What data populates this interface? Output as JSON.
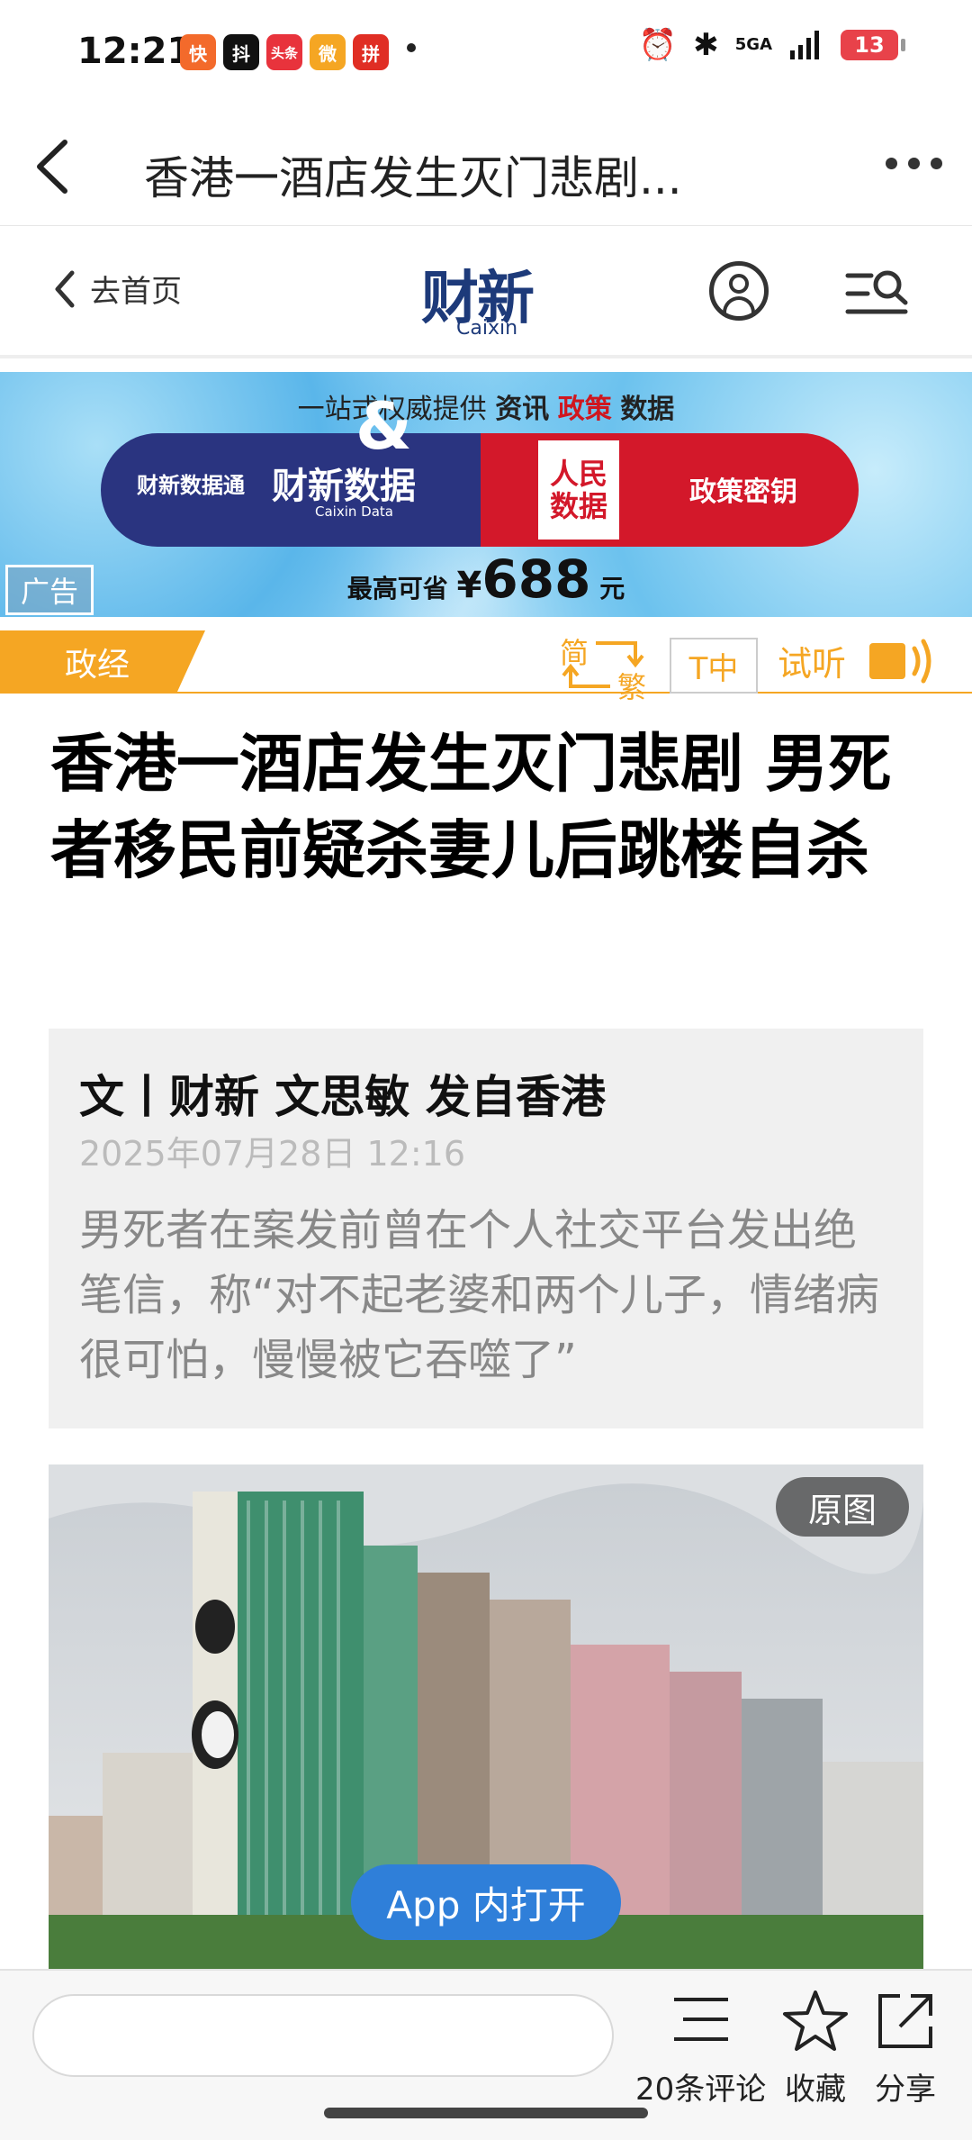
{
  "status_bar": {
    "time": "12:21",
    "app_badges": [
      "快",
      "抖",
      "头条",
      "微",
      "拼"
    ],
    "network": "5GA",
    "battery": "13"
  },
  "title_bar": {
    "title": "香港一酒店发生灭门悲剧..."
  },
  "site_header": {
    "home_link": "去首页",
    "logo_cn": "财新",
    "logo_en": "Caixin"
  },
  "ad": {
    "topline_prefix": "一站式权威提供",
    "topline_word1": "资讯",
    "topline_word2": "政策",
    "topline_word3": "数据",
    "brand_1": "财新数据通",
    "brand_2": "财新数据",
    "brand_2_sub": "Caixin Data",
    "amp": "&",
    "people_logo": "人民数据",
    "policy": "政策密钥",
    "price_prefix": "最高可省",
    "price_currency": "¥",
    "price_value": "688",
    "price_unit": "元",
    "label": "广告"
  },
  "article_toolbar": {
    "category": "政经",
    "convert_simplified": "简",
    "convert_traditional": "繁",
    "font_size": "T中",
    "listen": "试听"
  },
  "article": {
    "headline": "香港一酒店发生灭门悲剧 男死者移民前疑杀妻儿后跳楼自杀",
    "byline": "文丨财新 文思敏 发自香港",
    "date": "2025年07月28日 12:16",
    "summary": "男死者在案发前曾在个人社交平台发出绝笔信，称“对不起老婆和两个儿子，情绪病很可怕，慢慢被它吞噬了”",
    "original_image_btn": "原图",
    "open_app_btn": "App 内打开"
  },
  "bottom_bar": {
    "comment_placeholder": "",
    "comments_label": "20条评论",
    "favorite_label": "收藏",
    "share_label": "分享"
  },
  "colors": {
    "accent_orange": "#f5a623",
    "brand_navy": "#1d3a7a",
    "ad_red": "#d3182a",
    "open_app_blue": "#2f7fd9"
  }
}
